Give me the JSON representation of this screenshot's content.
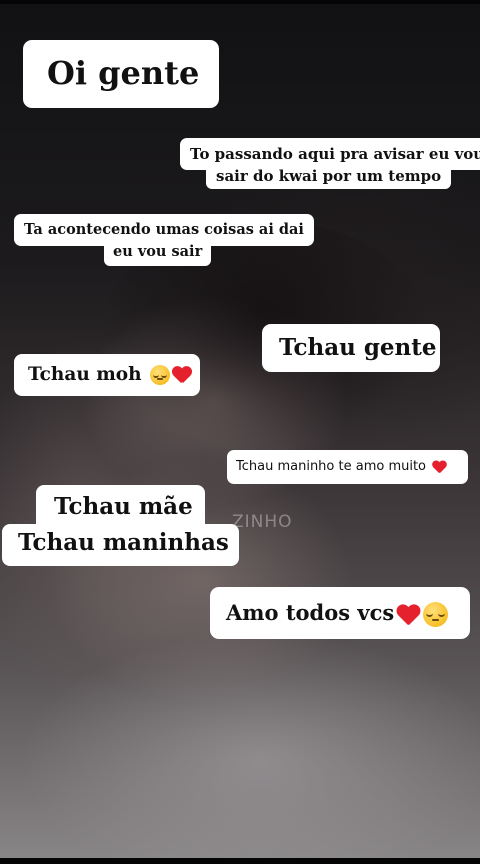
{
  "captions": {
    "title": "Oi gente",
    "passando_line1": "To passando aqui pra avisar eu vou",
    "passando_line2": "sair do kwai por um tempo",
    "acontecendo_line1": "Ta acontecendo umas coisas ai dai",
    "acontecendo_line2": "eu vou sair",
    "tchau_gente": "Tchau gente",
    "tchau_moh": "Tchau moh",
    "tchau_maninho": "Tchau maninho te amo muito",
    "tchau_mae": "Tchau mãe",
    "tchau_maninhas": "Tchau maninhas",
    "amo_todos": "Amo todos vcs"
  },
  "watermark": "ZINHO",
  "icons": {
    "pensive": "pensive-face-icon",
    "heart": "red-heart-icon"
  },
  "colors": {
    "caption_bg": "#ffffff",
    "caption_text": "#111111",
    "heart": "#e6212e",
    "face": "#f6bf26"
  }
}
